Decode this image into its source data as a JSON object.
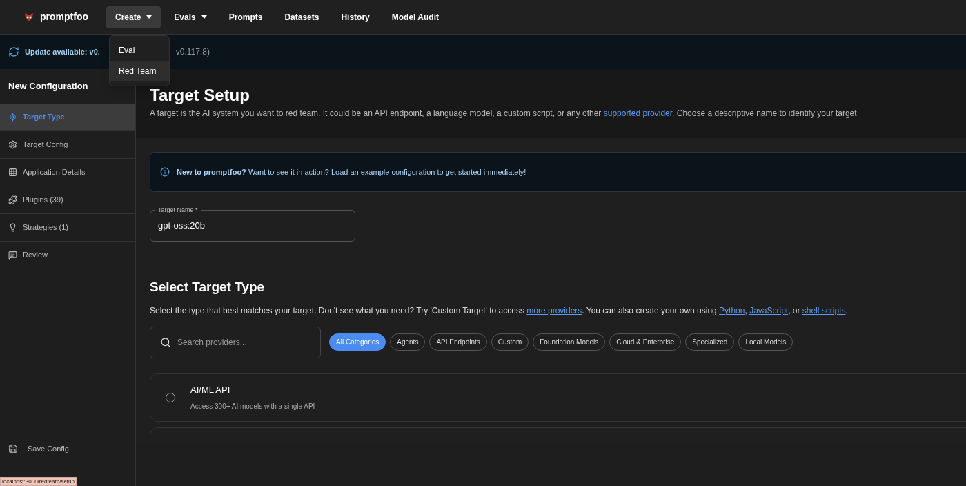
{
  "nav": {
    "brand": "promptfoo",
    "items": [
      {
        "label": "Create",
        "selected": true,
        "has_menu": true
      },
      {
        "label": "Evals",
        "selected": false,
        "has_menu": true
      },
      {
        "label": "Prompts",
        "selected": false,
        "has_menu": false
      },
      {
        "label": "Datasets",
        "selected": false,
        "has_menu": false
      },
      {
        "label": "History",
        "selected": false,
        "has_menu": false
      },
      {
        "label": "Model Audit",
        "selected": false,
        "has_menu": false
      }
    ]
  },
  "create_menu": {
    "items": [
      {
        "label": "Eval",
        "selected": false
      },
      {
        "label": "Red Team",
        "selected": true
      }
    ]
  },
  "banner": {
    "text": "Update available: v0.",
    "tail": "v0.117.8)"
  },
  "sidebar": {
    "title": "New Configuration",
    "items": [
      {
        "label": "Target Type",
        "selected": true
      },
      {
        "label": "Target Config",
        "selected": false
      },
      {
        "label": "Application Details",
        "selected": false
      },
      {
        "label": "Plugins (39)",
        "selected": false
      },
      {
        "label": "Strategies (1)",
        "selected": false
      },
      {
        "label": "Review",
        "selected": false
      }
    ],
    "footer_items": [
      {
        "label": "Save Config"
      }
    ]
  },
  "header": {
    "title": "Target Setup",
    "description": [
      {
        "kind": "text",
        "text": "A target is the AI system you want to red team. It could be an API endpoint, a language model, a custom script, or any other "
      },
      {
        "kind": "link",
        "text": "supported provider"
      },
      {
        "kind": "text",
        "text": ". Choose a descriptive name to identify your target"
      }
    ]
  },
  "info": {
    "text": "**New to promptfoo?** Want to see it in action? Load an example configuration to get started immediately!"
  },
  "target_name": {
    "label": "Target Name *",
    "value": "gpt-oss:20b"
  },
  "select": {
    "title": "Select Target Type",
    "description": [
      {
        "kind": "text",
        "text": "Select the type that best matches your target. Don't see what you need? Try 'Custom Target' to access "
      },
      {
        "kind": "link",
        "text": "more providers"
      },
      {
        "kind": "text",
        "text": ". You can also create your own using "
      },
      {
        "kind": "link",
        "text": "Python"
      },
      {
        "kind": "text",
        "text": ", "
      },
      {
        "kind": "link",
        "text": "JavaScript"
      },
      {
        "kind": "text",
        "text": ", or "
      },
      {
        "kind": "link",
        "text": "shell scripts"
      },
      {
        "kind": "text",
        "text": "."
      }
    ],
    "search": {
      "placeholder": "Search providers..."
    },
    "categories": [
      {
        "label": "All Categories",
        "selected": true
      },
      {
        "label": "Agents",
        "selected": false
      },
      {
        "label": "API Endpoints",
        "selected": false
      },
      {
        "label": "Custom",
        "selected": false
      },
      {
        "label": "Foundation Models",
        "selected": false
      },
      {
        "label": "Cloud & Enterprise",
        "selected": false
      },
      {
        "label": "Specialized",
        "selected": false
      },
      {
        "label": "Local Models",
        "selected": false
      }
    ],
    "providers": [
      {
        "name": "AI/ML API",
        "description": "Access 300+ AI models with a single API",
        "selected": false
      }
    ]
  },
  "status_url": "localhost:3000/redteam/setup"
}
